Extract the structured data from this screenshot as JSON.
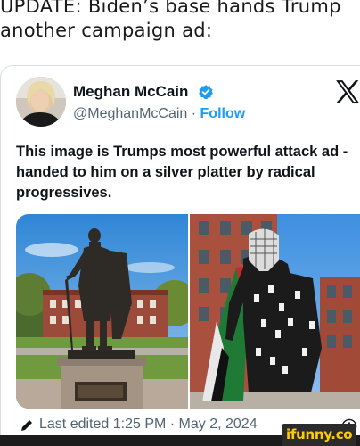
{
  "caption": {
    "line1": "UPDATE: Biden’s base hands Trump",
    "line2": "another campaign ad:"
  },
  "tweet": {
    "author_name": "Meghan McCain",
    "handle": "@MeghanMcCain",
    "separator": " · ",
    "follow_label": "Follow",
    "text": "This image is Trumps most powerful attack ad - handed to him on a silver platter by radical progressives.",
    "edited_label": "Last edited 1:25 PM · May 2, 2024"
  },
  "icons": {
    "verified": "verified-badge-icon",
    "platform": "x-logo-icon",
    "edit": "pencil-icon",
    "info": "info-icon"
  },
  "colors": {
    "link": "#1d9bf0",
    "muted": "#536471",
    "text": "#0f1419",
    "watermark": "#ffcc00"
  },
  "watermark": {
    "text": "ifunny.co"
  }
}
